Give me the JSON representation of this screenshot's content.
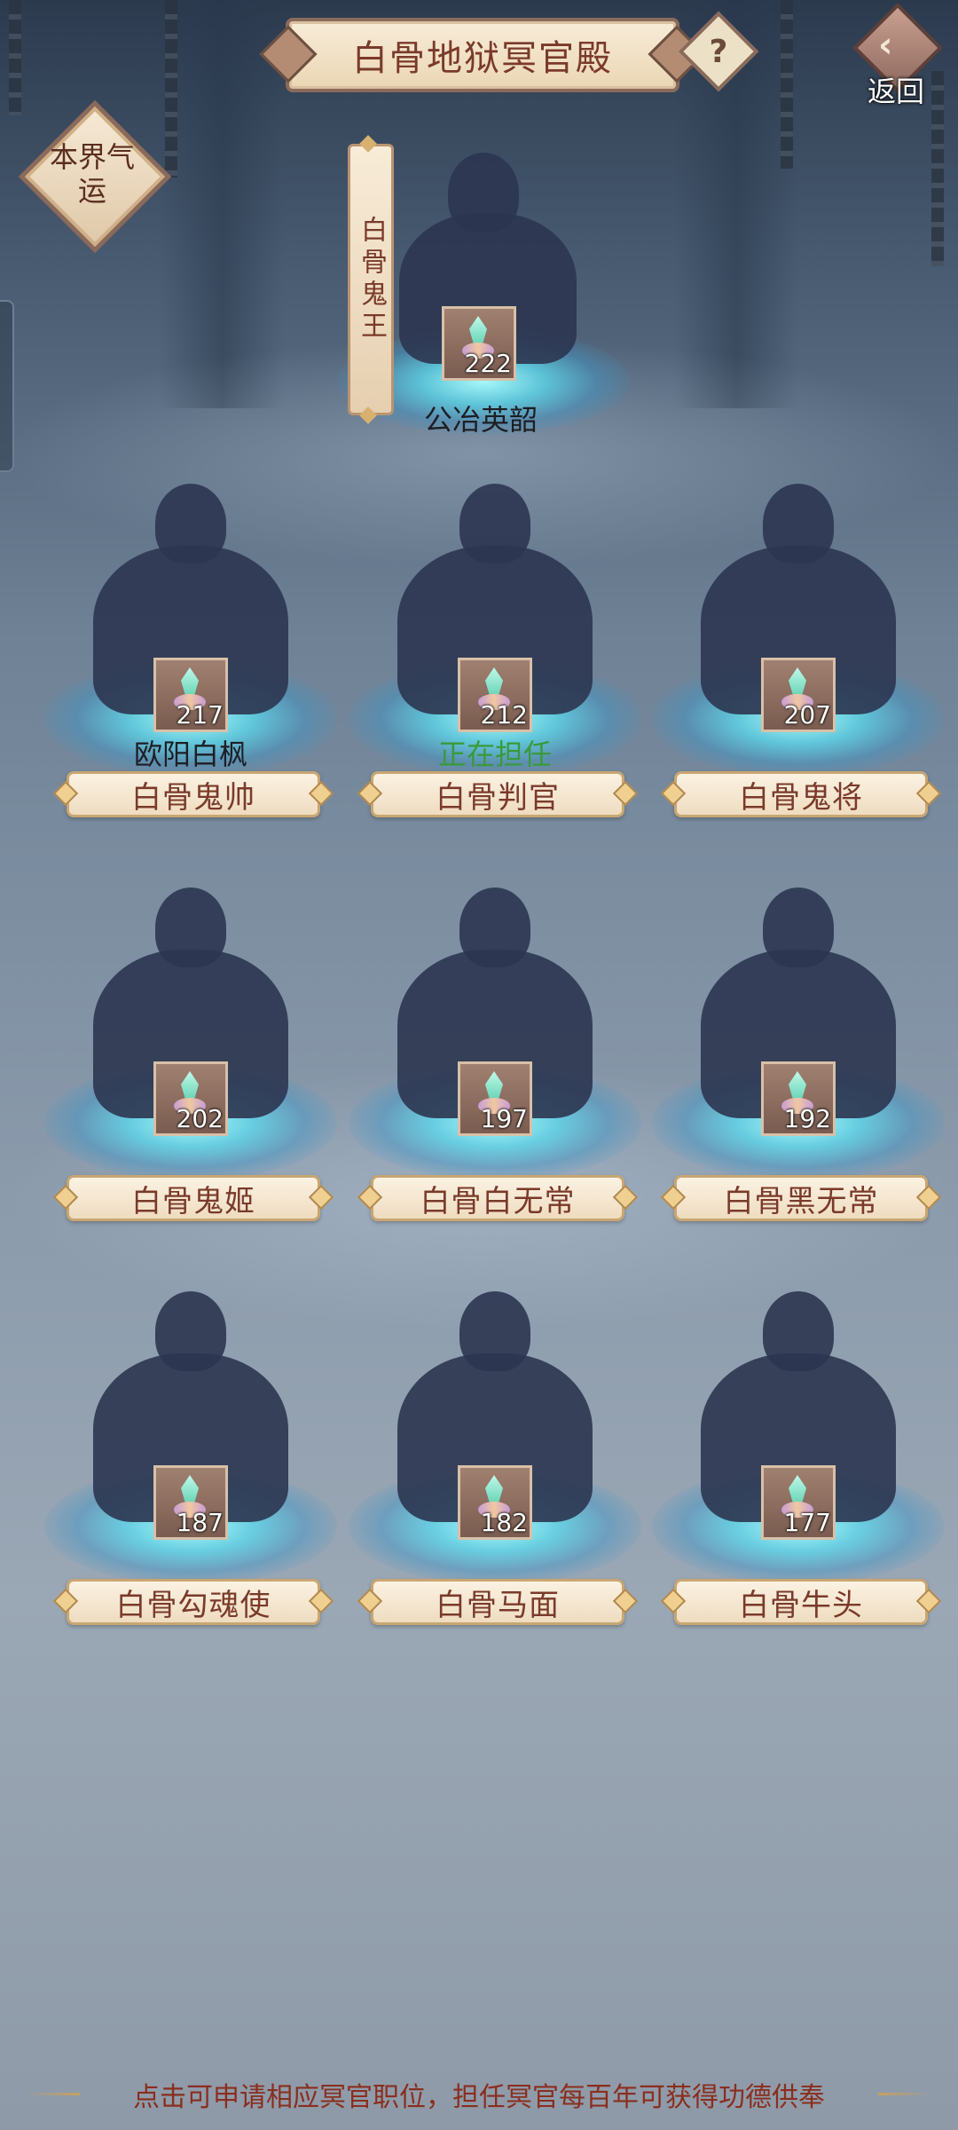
{
  "header": {
    "title": "白骨地狱冥官殿",
    "help_label": "?",
    "back_label": "返回"
  },
  "fortune": {
    "label": "本界气运"
  },
  "king": {
    "position": "白骨鬼王",
    "level": "222",
    "holder": "公冶英韶"
  },
  "slots": [
    {
      "position": "白骨鬼帅",
      "level": "217",
      "holder": "欧阳白枫",
      "holder_color": "#1e1e24"
    },
    {
      "position": "白骨判官",
      "level": "212",
      "holder": "正在担任",
      "holder_color": "#3a9a3a"
    },
    {
      "position": "白骨鬼将",
      "level": "207",
      "holder": ""
    },
    {
      "position": "白骨鬼姬",
      "level": "202",
      "holder": ""
    },
    {
      "position": "白骨白无常",
      "level": "197",
      "holder": ""
    },
    {
      "position": "白骨黑无常",
      "level": "192",
      "holder": ""
    },
    {
      "position": "白骨勾魂使",
      "level": "187",
      "holder": ""
    },
    {
      "position": "白骨马面",
      "level": "182",
      "holder": ""
    },
    {
      "position": "白骨牛头",
      "level": "177",
      "holder": ""
    }
  ],
  "footer": {
    "hint": "点击可申请相应冥官职位，担任冥官每百年可获得功德供奉"
  },
  "colors": {
    "accent_text": "#7a3a2a",
    "holder_active": "#3a9a3a",
    "footer_text": "#8a2e1e"
  }
}
